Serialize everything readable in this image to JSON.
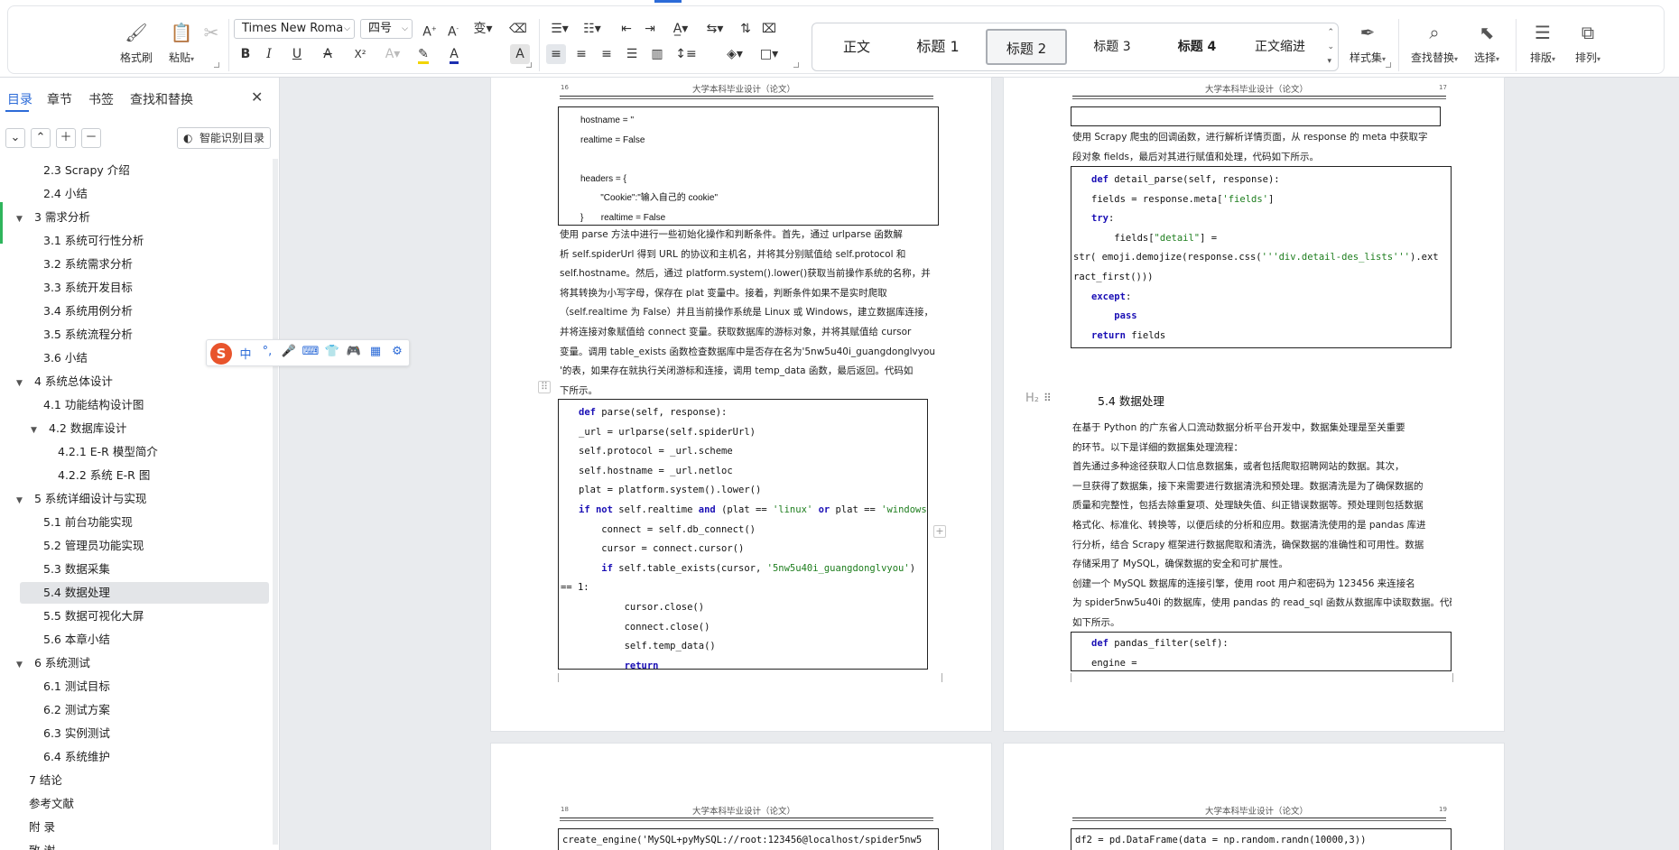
{
  "ribbon": {
    "format_painter": "格式刷",
    "paste": "粘贴",
    "font_name": "Times New Roma",
    "font_size": "四号",
    "styles": [
      "正文",
      "标题 1",
      "标题 2",
      "标题 3",
      "标题 4",
      "正文缩进"
    ],
    "style_set": "样式集",
    "find_replace": "查找替换",
    "select": "选择",
    "layout": "排版",
    "arrange": "排列",
    "icons": {
      "bold": "B",
      "italic": "I",
      "underline": "U",
      "strike": "A",
      "superscript": "X²"
    }
  },
  "sidebar": {
    "tabs": [
      "目录",
      "章节",
      "书签",
      "查找和替换"
    ],
    "smart_toc": "智能识别目录",
    "toc": [
      {
        "label": "2.3 Scrapy 介绍",
        "level": 2
      },
      {
        "label": "2.4 小结",
        "level": 2
      },
      {
        "label": "3  需求分析",
        "level": 1
      },
      {
        "label": "3.1 系统可行性分析",
        "level": 2
      },
      {
        "label": "3.2 系统需求分析",
        "level": 2
      },
      {
        "label": "3.3 系统开发目标",
        "level": 2
      },
      {
        "label": "3.4 系统用例分析",
        "level": 2
      },
      {
        "label": "3.5 系统流程分析",
        "level": 2
      },
      {
        "label": "3.6 小结",
        "level": 2
      },
      {
        "label": "4  系统总体设计",
        "level": 1
      },
      {
        "label": "4.1 功能结构设计图",
        "level": 2
      },
      {
        "label": "4.2  数据库设计",
        "level": 2
      },
      {
        "label": "4.2.1    E-R 模型简介",
        "level": 3
      },
      {
        "label": "4.2.2    系统 E-R 图",
        "level": 3
      },
      {
        "label": "5  系统详细设计与实现",
        "level": 1
      },
      {
        "label": "5.1 前台功能实现",
        "level": 2
      },
      {
        "label": "5.2 管理员功能实现",
        "level": 2
      },
      {
        "label": "5.3 数据采集",
        "level": 2
      },
      {
        "label": "5.4 数据处理",
        "level": 2
      },
      {
        "label": "5.5 数据可视化大屏",
        "level": 2
      },
      {
        "label": "5.6  本章小结",
        "level": 2
      },
      {
        "label": "6  系统测试",
        "level": 1
      },
      {
        "label": "6.1  测试目标",
        "level": 2
      },
      {
        "label": "6.2  测试方案",
        "level": 2
      },
      {
        "label": "6.3  实例测试",
        "level": 2
      },
      {
        "label": "6.4  系统维护",
        "level": 2
      },
      {
        "label": "7  结论",
        "level": 0
      },
      {
        "label": "参考文献",
        "level": 0
      },
      {
        "label": "附  录",
        "level": 0
      },
      {
        "label": "致  谢",
        "level": 0
      }
    ],
    "selected": "5.4 数据处理"
  },
  "ime": {
    "logo": "S",
    "lang": "中",
    "punct": "°,"
  },
  "doc": {
    "running_head": "大学本科毕业设计（论文）",
    "page16": {
      "number": "16",
      "code_top": [
        "hostname = ''",
        "realtime = False",
        "",
        "headers = {",
        "        \"Cookie\":\"输入自己的 cookie\"",
        "}       realtime = False"
      ],
      "para": [
        "    使用 parse 方法中进行一些初始化操作和判断条件。首先，通过 urlparse 函数解",
        "析 self.spiderUrl 得到 URL 的协议和主机名，并将其分别赋值给 self.protocol 和",
        "self.hostname。然后，通过 platform.system().lower()获取当前操作系统的名称，并",
        "将其转换为小写字母，保存在 plat 变量中。接着，判断条件如果不是实时爬取",
        "（self.realtime 为 False）并且当前操作系统是 Linux 或 Windows，建立数据库连接，",
        "并将连接对象赋值给 connect 变量。获取数据库的游标对象，并将其赋值给 cursor",
        "变量。调用 table_exists 函数检查数据库中是否存在名为'5nw5u40i_guangdonglvyou",
        "'的表，如果存在就执行关闭游标和连接，调用 temp_data 函数，最后返回。代码如",
        "下所示。"
      ],
      "code": [
        "def parse(self, response):",
        "_url = urlparse(self.spiderUrl)",
        "self.protocol = _url.scheme",
        "self.hostname = _url.netloc",
        "plat = platform.system().lower()",
        "if not self.realtime and (plat == 'linux' or plat == 'windows'):",
        "    connect = self.db_connect()",
        "    cursor = connect.cursor()",
        "    if self.table_exists(cursor, '5nw5u40i_guangdonglvyou')",
        "== 1:",
        "        cursor.close()",
        "        connect.close()",
        "        self.temp_data()",
        "        return"
      ]
    },
    "page17": {
      "number": "17",
      "para1": [
        "    使用 Scrapy 爬虫的回调函数，进行解析详情页面，从 response 的 meta 中获取字",
        "段对象 fields，最后对其进行赋值和处理，代码如下所示。"
      ],
      "code": [
        "def detail_parse(self, response):",
        "fields = response.meta['fields']",
        "try:",
        "    fields[\"detail\"] =",
        "str( emoji.demojize(response.css('''div.detail-des_lists''').ext",
        "ract_first()))",
        "except:",
        "    pass",
        "return fields"
      ],
      "heading": "5.4 数据处理",
      "h2": "H₂",
      "para2": [
        "    在基于 Python 的广东省人口流动数据分析平台开发中，数据集处理是至关重要",
        "的环节。以下是详细的数据集处理流程：",
        "    首先通过多种途径获取人口信息数据集，或者包括爬取招聘网站的数据。其次，",
        "一旦获得了数据集，接下来需要进行数据清洗和预处理。数据清洗是为了确保数据的",
        "质量和完整性，包括去除重复项、处理缺失值、纠正错误数据等。预处理则包括数据",
        "格式化、标准化、转换等，以便后续的分析和应用。数据清洗使用的是 pandas 库进",
        "行分析，结合 Scrapy 框架进行数据爬取和清洗，确保数据的准确性和可用性。数据",
        "存储采用了 MySQL，确保数据的安全和可扩展性。",
        "    创建一个 MySQL 数据库的连接引擎，使用 root 用户和密码为 123456 来连接名",
        "为 spider5nw5u40i 的数据库，使用 pandas 的 read_sql 函数从数据库中读取数据。代码",
        "如下所示。"
      ],
      "code2": [
        "def pandas_filter(self):",
        "engine ="
      ]
    },
    "page18": {
      "number": "18",
      "code": "create_engine('MySQL+pyMySQL://root:123456@localhost/spider5nw5"
    },
    "page19": {
      "number": "19",
      "code": "df2 = pd.DataFrame(data = np.random.randn(10000,3))"
    }
  }
}
